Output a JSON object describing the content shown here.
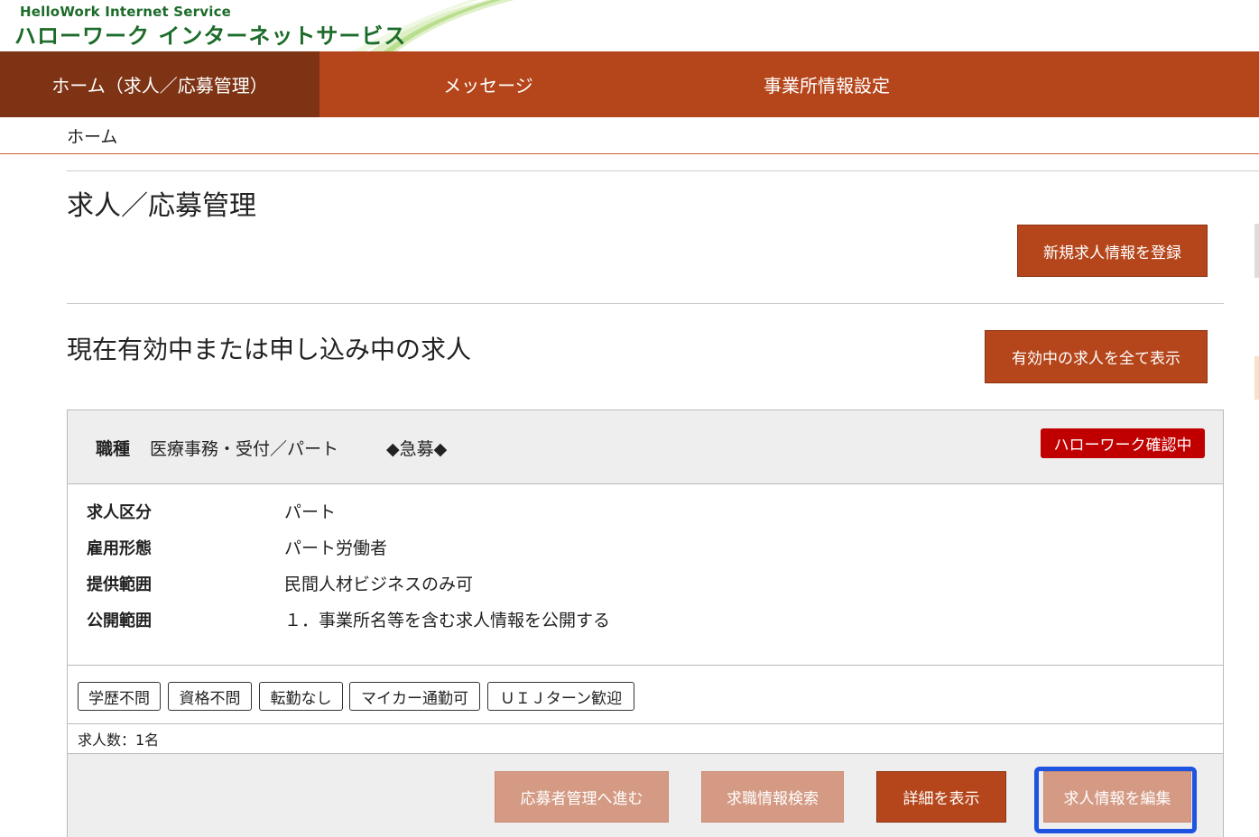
{
  "header": {
    "logo_en": "HelloWork Internet Service",
    "logo_jp": "ハローワーク インターネットサービス"
  },
  "nav": {
    "items": [
      {
        "label": "ホーム（求人／応募管理）",
        "active": true
      },
      {
        "label": "メッセージ",
        "active": false
      },
      {
        "label": "事業所情報設定",
        "active": false
      }
    ]
  },
  "breadcrumb": "ホーム",
  "page_title": "求人／応募管理",
  "register_button": "新規求人情報を登録",
  "section_title": "現在有効中または申し込み中の求人",
  "show_all_button": "有効中の求人を全て表示",
  "job": {
    "type_label": "職種",
    "type_value": "医療事務・受付／パート",
    "urgent": "◆急募◆",
    "status": "ハローワーク確認中",
    "details": [
      {
        "label": "求人区分",
        "value": "パート"
      },
      {
        "label": "雇用形態",
        "value": "パート労働者"
      },
      {
        "label": "提供範囲",
        "value": "民間人材ビジネスのみ可"
      },
      {
        "label": "公開範囲",
        "value": "１．事業所名等を含む求人情報を公開する"
      }
    ],
    "tags": [
      "学歴不問",
      "資格不問",
      "転勤なし",
      "マイカー通勤可",
      "ＵＩＪターン歓迎"
    ],
    "count": "求人数：1名",
    "actions": {
      "applicants": "応募者管理へ進む",
      "search": "求職情報検索",
      "details": "詳細を表示",
      "edit": "求人情報を編集"
    }
  },
  "colors": {
    "nav": "#b5461b",
    "nav_active": "#7e3314",
    "status": "#c00000",
    "highlight": "#1f54e0",
    "logo": "#1c6b2a"
  }
}
